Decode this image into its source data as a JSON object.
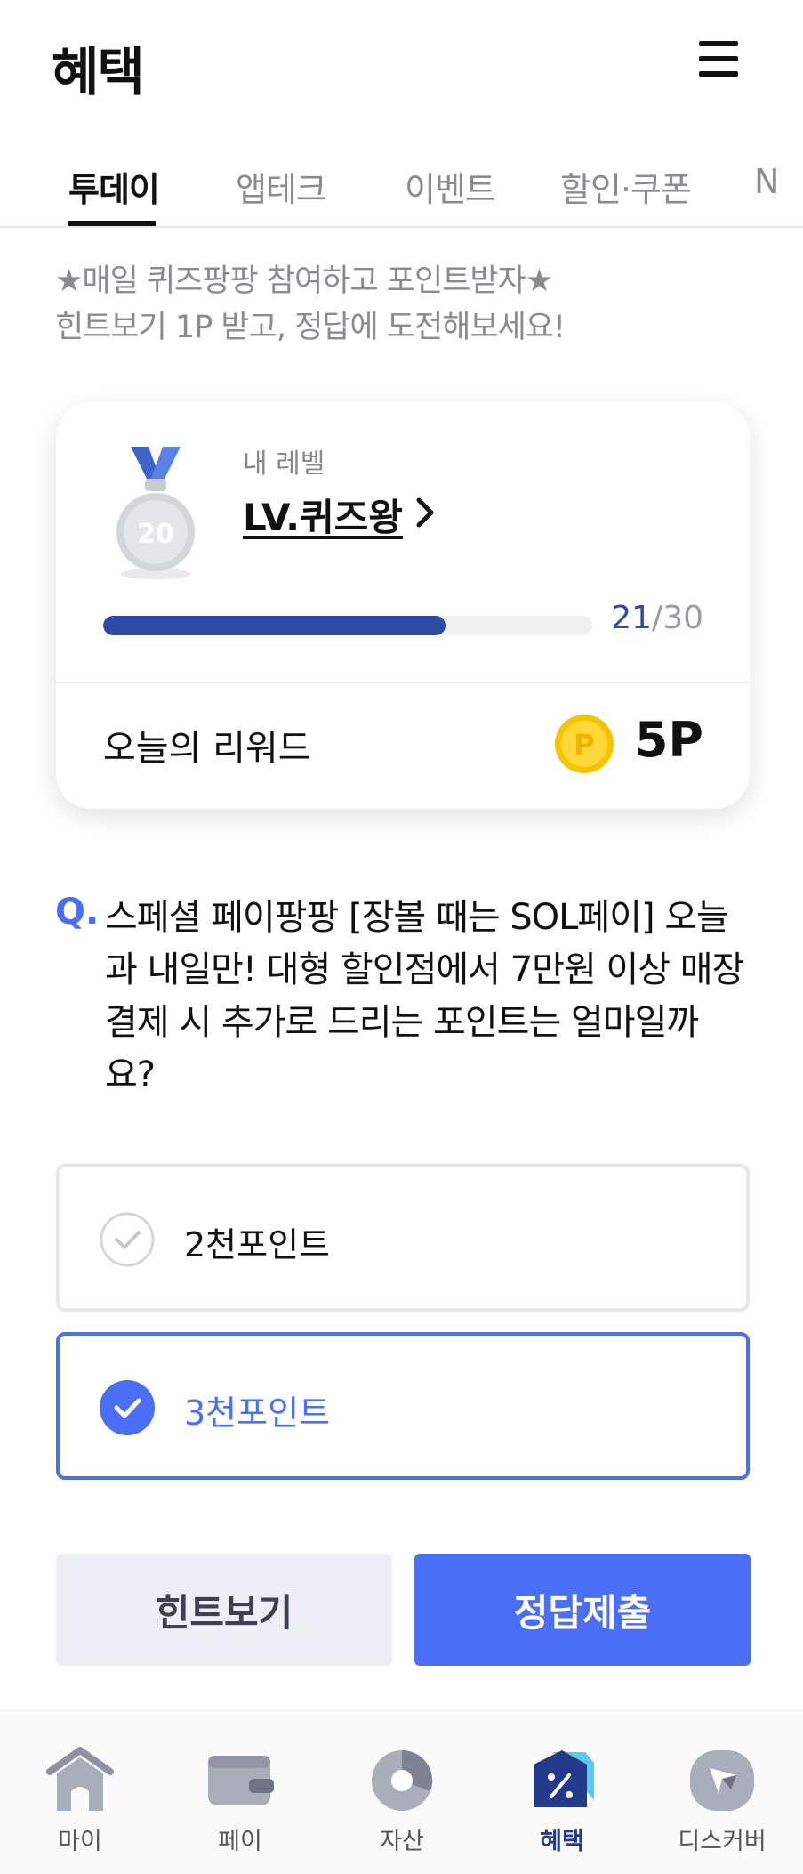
{
  "header": {
    "title": "혜택",
    "menu_icon": "hamburger-menu-icon"
  },
  "tabs": [
    {
      "label": "투데이",
      "active": true
    },
    {
      "label": "앱테크",
      "active": false
    },
    {
      "label": "이벤트",
      "active": false
    },
    {
      "label": "할인·쿠폰",
      "active": false
    },
    {
      "label": "N",
      "active": false
    }
  ],
  "intro": {
    "line1": "★매일 퀴즈팡팡 참여하고 포인트받자★",
    "line2": "힌트보기 1P 받고, 정답에 도전해보세요!"
  },
  "level_card": {
    "medal_number": "20",
    "caption": "내 레벨",
    "level_name": "LV.퀴즈왕",
    "progress_current": "21",
    "progress_separator": "/",
    "progress_total": "30",
    "progress_ratio": 0.7,
    "reward_label": "오늘의 리워드",
    "reward_value": "5P",
    "reward_icon": "point-coin-icon"
  },
  "question": {
    "marker": "Q.",
    "text": "스페셜 페이팡팡 [장볼 때는 SOL페이] 오늘과 내일만! 대형 할인점에서 7만원 이상 매장결제 시 추가로 드리는 포인트는 얼마일까요?"
  },
  "options": [
    {
      "label": "2천포인트",
      "selected": false
    },
    {
      "label": "3천포인트",
      "selected": true
    }
  ],
  "actions": {
    "hint_label": "힌트보기",
    "submit_label": "정답제출"
  },
  "bottom_nav": [
    {
      "label": "마이",
      "icon": "home-icon",
      "active": false
    },
    {
      "label": "페이",
      "icon": "wallet-icon",
      "active": false
    },
    {
      "label": "자산",
      "icon": "pie-chart-icon",
      "active": false
    },
    {
      "label": "혜택",
      "icon": "discount-tag-icon",
      "active": true
    },
    {
      "label": "디스커버",
      "icon": "compass-icon",
      "active": false
    }
  ],
  "colors": {
    "accent": "#4a6ef5",
    "progress": "#2f4aa6",
    "nav_active": "#233a8a",
    "muted_text": "#8a8a90",
    "hint_button_bg": "#eeeff4"
  }
}
